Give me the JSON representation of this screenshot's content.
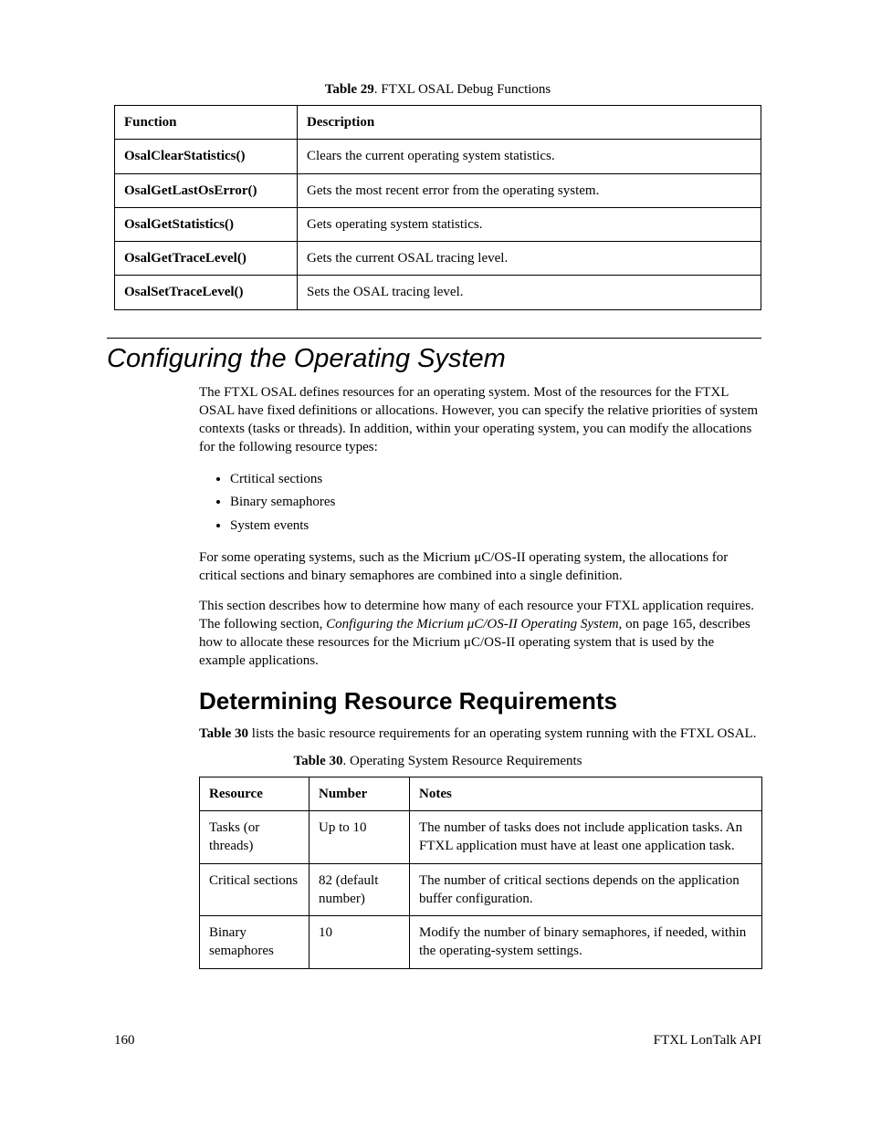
{
  "table29": {
    "caption_bold": "Table 29",
    "caption_rest": ". FTXL OSAL Debug Functions",
    "headers": {
      "c0": "Function",
      "c1": "Description"
    },
    "rows": [
      {
        "fn": "OsalClearStatistics()",
        "desc": "Clears the current operating system statistics."
      },
      {
        "fn": "OsalGetLastOsError()",
        "desc": "Gets the most recent error from the operating system."
      },
      {
        "fn": "OsalGetStatistics()",
        "desc": "Gets operating system statistics."
      },
      {
        "fn": "OsalGetTraceLevel()",
        "desc": "Gets the current OSAL tracing level."
      },
      {
        "fn": "OsalSetTraceLevel()",
        "desc": "Sets the OSAL tracing level."
      }
    ]
  },
  "section": {
    "title": "Configuring the Operating System"
  },
  "para1": "The FTXL OSAL defines resources for an operating system.  Most of the resources for the FTXL OSAL have fixed definitions or allocations.  However, you can specify the relative priorities of system contexts (tasks or threads).  In addition, within your operating system, you can modify the allocations for the following resource types:",
  "bullets": {
    "b0": "Crtitical sections",
    "b1": "Binary semaphores",
    "b2": "System events"
  },
  "para2": "For some operating systems, such as the Micrium μC/OS-II operating system, the allocations for critical sections and binary semaphores are combined into a single definition.",
  "para3_a": "This section describes how to determine how many of each resource your FTXL application requires.  The following section, ",
  "para3_i": "Configuring the Micrium μC/OS-II Operating System,",
  "para3_b": " on page 165, describes how to allocate these resources for the Micrium μC/OS-II operating system that is used by the example applications.",
  "subsection": {
    "title": "Determining Resource Requirements"
  },
  "para4_b": "Table 30",
  "para4_a": " lists the basic resource requirements for an operating system running with the FTXL OSAL.",
  "table30": {
    "caption_bold": "Table 30",
    "caption_rest": ". Operating System Resource Requirements",
    "headers": {
      "c0": "Resource",
      "c1": "Number",
      "c2": "Notes"
    },
    "rows": [
      {
        "res": "Tasks (or threads)",
        "num": "Up to 10",
        "notes": "The number of tasks does not include application tasks.  An FTXL application must have at least one application task."
      },
      {
        "res": "Critical sections",
        "num": "82 (default number)",
        "notes": "The number of critical sections depends on the application buffer configuration."
      },
      {
        "res": "Binary semaphores",
        "num": "10",
        "notes": "Modify the number of binary semaphores, if needed, within the operating-system settings."
      }
    ]
  },
  "footer": {
    "page": "160",
    "title": "FTXL LonTalk API"
  }
}
